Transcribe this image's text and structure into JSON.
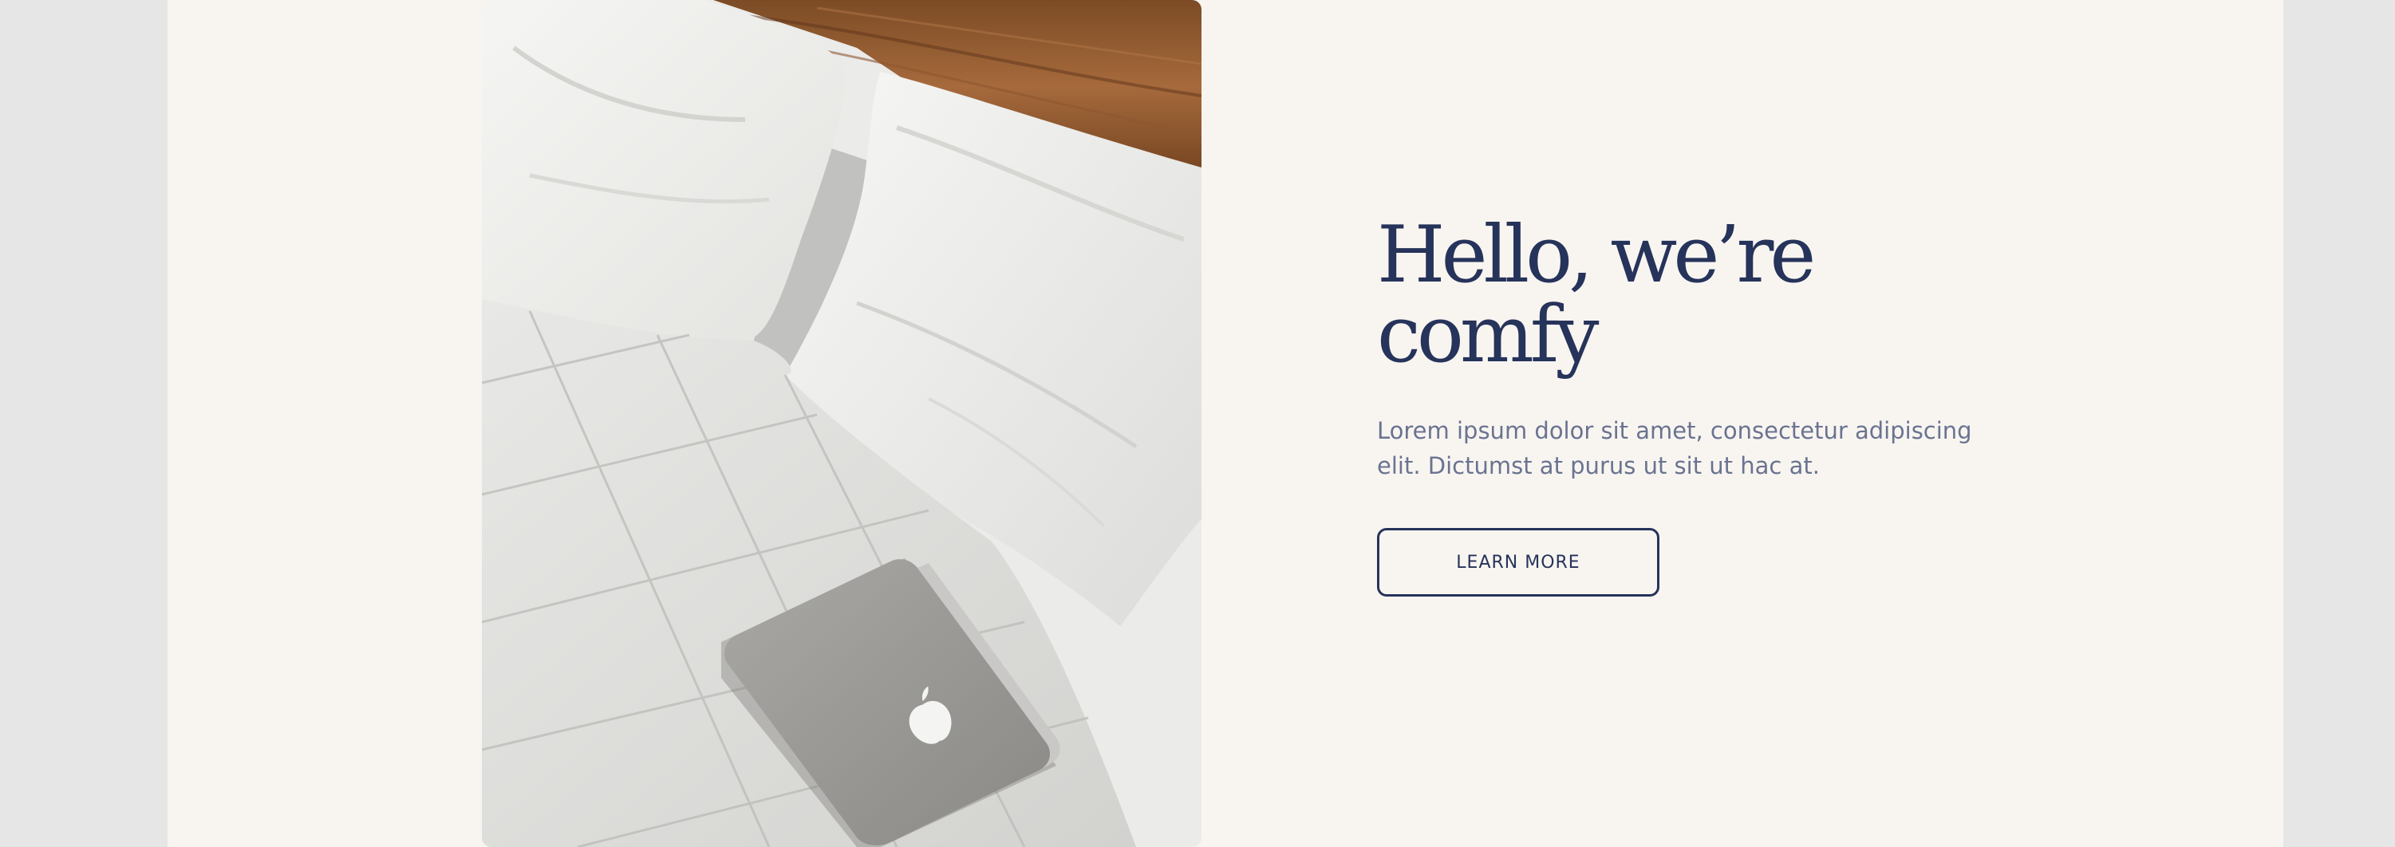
{
  "hero": {
    "title": "Hello, we’re comfy",
    "description": "Lorem ipsum dolor sit amet, consectetur adipiscing elit. Dictumst at purus ut sit ut hac at.",
    "button_label": "LEARN MORE"
  },
  "colors": {
    "outer_background": "#e6e6e6",
    "page_background": "#f8f5f1",
    "heading": "#26335a",
    "body_text": "#6a7390",
    "button_border": "#26335a"
  },
  "image": {
    "subject": "white bed with pillows, quilt and a closed laptop",
    "laptop_logo_icon": "apple-logo-icon"
  }
}
